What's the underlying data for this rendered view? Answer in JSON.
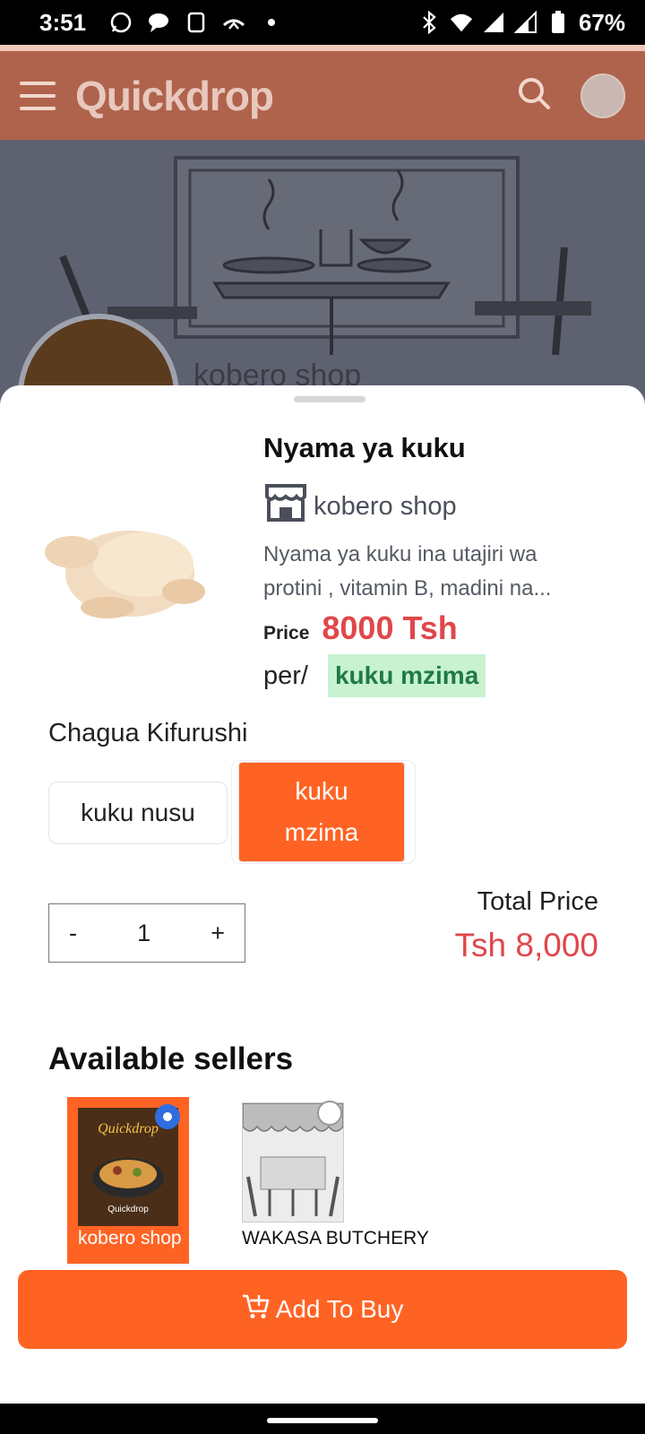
{
  "status_bar": {
    "time": "3:51",
    "battery": "67%",
    "icons": [
      "whatsapp-icon",
      "chat-icon",
      "sim-icon",
      "missed-call-icon",
      "dot-icon",
      "bluetooth-icon",
      "wifi-icon",
      "signal-icon",
      "battery-icon"
    ]
  },
  "header": {
    "brand": "Quickdrop",
    "icons": [
      "menu-icon",
      "search-icon",
      "avatar"
    ]
  },
  "banner": {
    "shop_name": "kobero shop"
  },
  "product": {
    "title": "Nyama ya kuku",
    "shop": "kobero shop",
    "description": "Nyama ya kuku ina utajiri wa protini , vitamin B, madini na...",
    "price_label": "Price",
    "price_value": "8000 Tsh",
    "per_label": "per/",
    "unit": "kuku mzima"
  },
  "package": {
    "title": "Chagua Kifurushi",
    "options": [
      {
        "label": "kuku nusu",
        "selected": false
      },
      {
        "label": "kuku mzima",
        "selected": true
      }
    ]
  },
  "quantity": {
    "minus": "-",
    "value": "1",
    "plus": "+"
  },
  "total": {
    "label": "Total Price",
    "value": "Tsh 8,000"
  },
  "sellers": {
    "title": "Available sellers",
    "items": [
      {
        "name": "kobero shop",
        "selected": true
      },
      {
        "name": "WAKASA BUTCHERY",
        "selected": false
      }
    ]
  },
  "actions": {
    "add_to_buy": "Add To Buy"
  },
  "colors": {
    "header": "#b0634c",
    "accent": "#ff6324",
    "price": "#e0474b",
    "unit_badge_bg": "#c8f2d2",
    "unit_badge_text": "#1f7a43"
  }
}
